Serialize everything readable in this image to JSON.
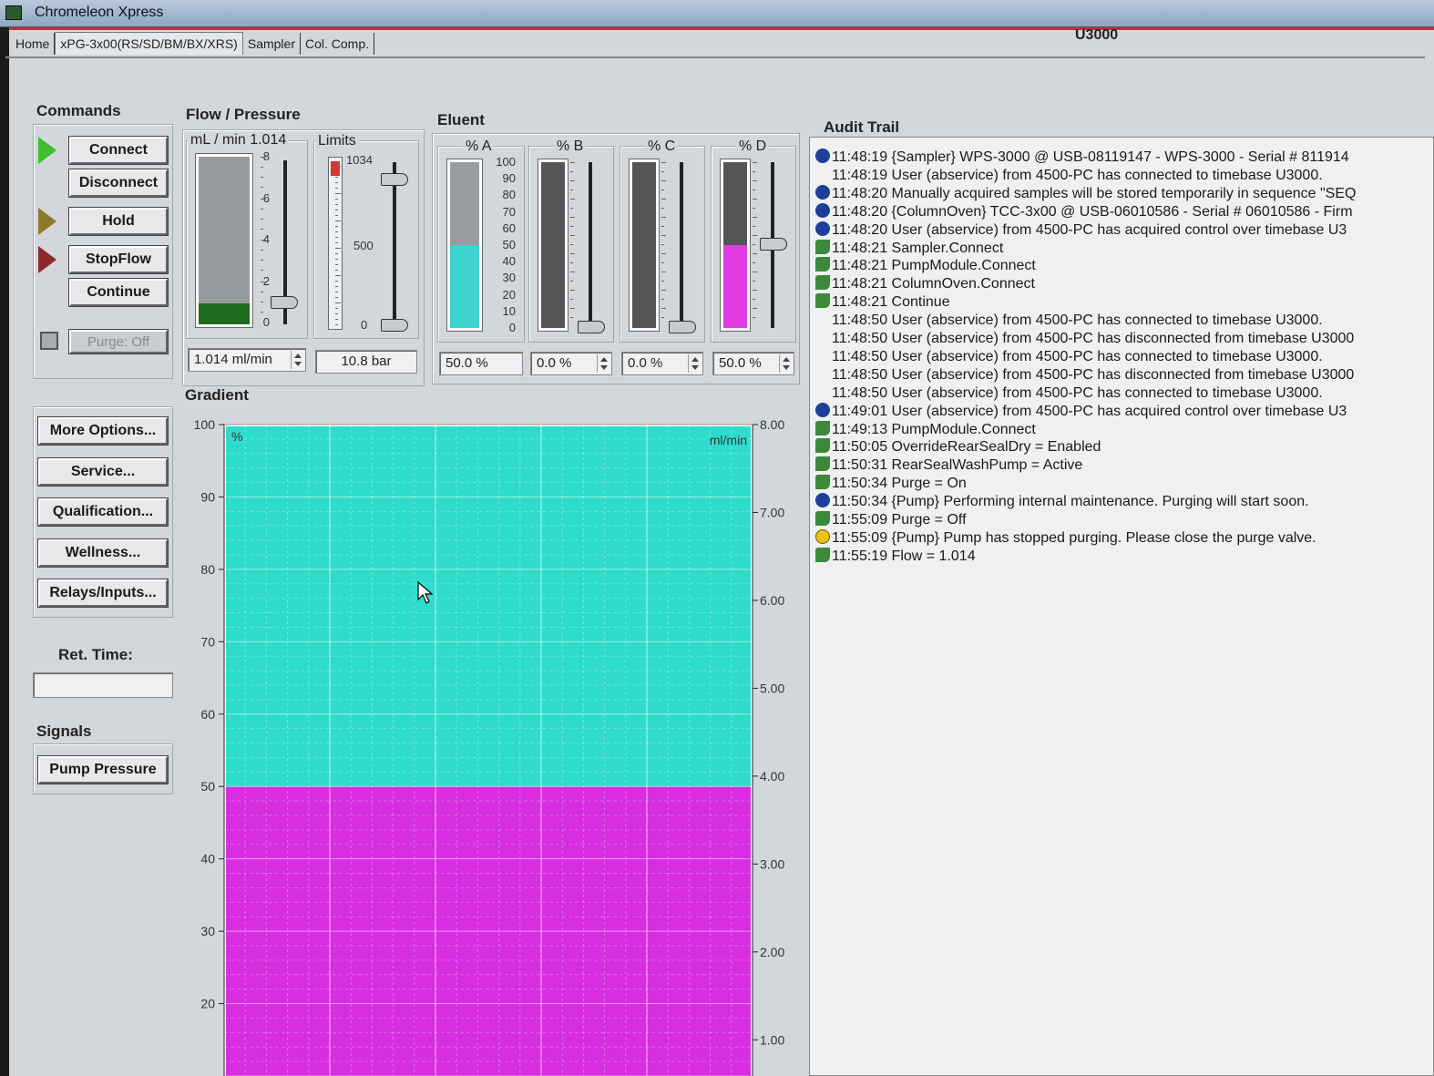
{
  "window": {
    "app_title": "Chromeleon Xpress",
    "device_title": "U3000"
  },
  "tabs": [
    "Home",
    "xPG-3x00(RS/SD/BM/BX/XRS)",
    "Sampler",
    "Col. Comp."
  ],
  "commands": {
    "title": "Commands",
    "connect": "Connect",
    "disconnect": "Disconnect",
    "hold": "Hold",
    "stopflow": "StopFlow",
    "continue": "Continue",
    "purge": "Purge: Off"
  },
  "options": {
    "more": "More Options...",
    "service": "Service...",
    "qualification": "Qualification...",
    "wellness": "Wellness...",
    "relays": "Relays/Inputs..."
  },
  "ret_time": {
    "label": "Ret. Time:",
    "value": ""
  },
  "signals": {
    "title": "Signals",
    "pump_pressure": "Pump Pressure"
  },
  "flow": {
    "title": "Flow / Pressure",
    "flow_legend": "mL / min 1.014",
    "flow_ticks": [
      "8",
      "6",
      "4",
      "2",
      "0"
    ],
    "flow_value": "1.014 ml/min",
    "flow_fraction": 0.127,
    "limits_legend": "Limits",
    "limits_ticks": [
      "1034",
      "500",
      "0"
    ],
    "pressure_value": "10.8 bar"
  },
  "eluent": {
    "title": "Eluent",
    "ticks": [
      "100",
      "90",
      "80",
      "70",
      "60",
      "50",
      "40",
      "30",
      "20",
      "10",
      "0"
    ],
    "channels": [
      {
        "label": "% A",
        "value": "50.0 %",
        "percent": 50,
        "color": "#3fd3cf"
      },
      {
        "label": "% B",
        "value": "0.0 %",
        "percent": 0,
        "color": "#3fd3cf"
      },
      {
        "label": "% C",
        "value": "0.0 %",
        "percent": 0,
        "color": "#3fd3cf"
      },
      {
        "label": "% D",
        "value": "50.0 %",
        "percent": 50,
        "color": "#e23be6"
      }
    ]
  },
  "gradient": {
    "title": "Gradient",
    "left_unit": "%",
    "right_unit": "ml/min",
    "left_ticks": [
      "100",
      "90",
      "80",
      "70",
      "60",
      "50",
      "40",
      "30",
      "20"
    ],
    "right_ticks": [
      "8.00",
      "7.00",
      "6.00",
      "5.00",
      "4.00",
      "3.00",
      "2.00",
      "1.00"
    ],
    "a_color": "#2fdccc",
    "d_color": "#d62ee0"
  },
  "chart_data": {
    "type": "area",
    "title": "Gradient",
    "ylabel": "%",
    "y2label": "ml/min",
    "ylim": [
      10,
      100
    ],
    "y2lim": [
      1.0,
      8.0
    ],
    "series": [
      {
        "name": "% A",
        "values": [
          50,
          50
        ],
        "color": "#2fdccc"
      },
      {
        "name": "% D",
        "values": [
          50,
          50
        ],
        "color": "#d62ee0"
      }
    ],
    "grid": true
  },
  "audit": {
    "title": "Audit Trail",
    "rows": [
      {
        "icon": "info",
        "text": "11:48:19 {Sampler} WPS-3000 @ USB-08119147 - WPS-3000 - Serial # 811914"
      },
      {
        "icon": "none",
        "text": "11:48:19 User  (abservice) from 4500-PC has connected to timebase U3000."
      },
      {
        "icon": "info",
        "text": "11:48:20 Manually acquired samples will be stored temporarily in sequence \"SEQ"
      },
      {
        "icon": "info",
        "text": "11:48:20 {ColumnOven} TCC-3x00 @ USB-06010586 - Serial # 06010586 - Firm"
      },
      {
        "icon": "info",
        "text": "11:48:20 User  (abservice) from 4500-PC has acquired control over timebase U3"
      },
      {
        "icon": "cmd",
        "text": "11:48:21 Sampler.Connect"
      },
      {
        "icon": "cmd",
        "text": "11:48:21 PumpModule.Connect"
      },
      {
        "icon": "cmd",
        "text": "11:48:21 ColumnOven.Connect"
      },
      {
        "icon": "cmd",
        "text": "11:48:21 Continue"
      },
      {
        "icon": "none",
        "text": "11:48:50 User  (abservice) from 4500-PC has connected to timebase U3000."
      },
      {
        "icon": "none",
        "text": "11:48:50 User  (abservice) from 4500-PC has disconnected from timebase U3000"
      },
      {
        "icon": "none",
        "text": "11:48:50 User  (abservice) from 4500-PC has connected to timebase U3000."
      },
      {
        "icon": "none",
        "text": "11:48:50 User  (abservice) from 4500-PC has disconnected from timebase U3000"
      },
      {
        "icon": "none",
        "text": "11:48:50 User  (abservice) from 4500-PC has connected to timebase U3000."
      },
      {
        "icon": "info",
        "text": "11:49:01 User  (abservice) from 4500-PC has acquired control over timebase U3"
      },
      {
        "icon": "cmd",
        "text": "11:49:13 PumpModule.Connect"
      },
      {
        "icon": "cmd",
        "text": "11:50:05 OverrideRearSealDry = Enabled"
      },
      {
        "icon": "cmd",
        "text": "11:50:31 RearSealWashPump = Active"
      },
      {
        "icon": "cmd",
        "text": "11:50:34 Purge = On"
      },
      {
        "icon": "info",
        "text": "11:50:34 {Pump} Performing internal maintenance. Purging will start soon."
      },
      {
        "icon": "cmd",
        "text": "11:55:09 Purge = Off"
      },
      {
        "icon": "warn",
        "text": "11:55:09 {Pump} Pump has stopped purging. Please close the purge valve."
      },
      {
        "icon": "cmd",
        "text": "11:55:19 Flow = 1.014"
      }
    ]
  }
}
